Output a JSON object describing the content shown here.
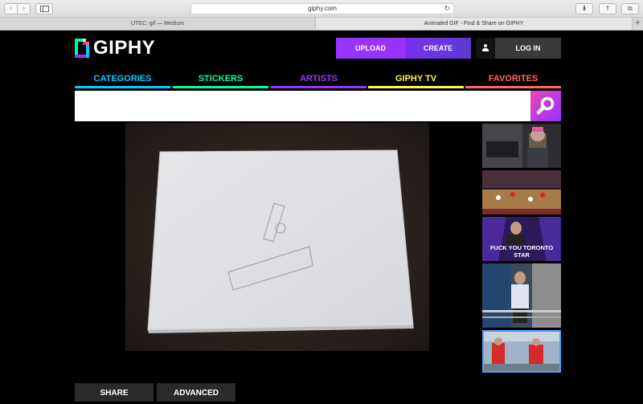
{
  "browser": {
    "url": "giphy.com",
    "tabs": [
      {
        "title": "UTEC: gif — Medium"
      },
      {
        "title": "Animated GIF - Find & Share on GIPHY"
      }
    ]
  },
  "site": {
    "logo_text": "GIPHY",
    "header": {
      "upload_label": "UPLOAD",
      "create_label": "CREATE",
      "login_label": "LOG IN"
    },
    "nav": [
      {
        "label": "CATEGORIES",
        "color": "#00ccff"
      },
      {
        "label": "STICKERS",
        "color": "#00ff99"
      },
      {
        "label": "ARTISTS",
        "color": "#9933ff"
      },
      {
        "label": "GIPHY TV",
        "color": "#fff35c"
      },
      {
        "label": "FAVORITES",
        "color": "#ff6666"
      }
    ],
    "search": {
      "value": "",
      "placeholder": ""
    },
    "sidebar_thumbs": [
      {
        "caption": ""
      },
      {
        "caption": ""
      },
      {
        "caption": "FUCK YOU TORONTO STAR"
      },
      {
        "caption": ""
      },
      {
        "caption": ""
      }
    ],
    "actions": {
      "share_label": "SHARE",
      "advanced_label": "ADVANCED"
    }
  },
  "colors": {
    "upload": "#9933ff",
    "search_button": "#e646b6",
    "background": "#000000"
  }
}
